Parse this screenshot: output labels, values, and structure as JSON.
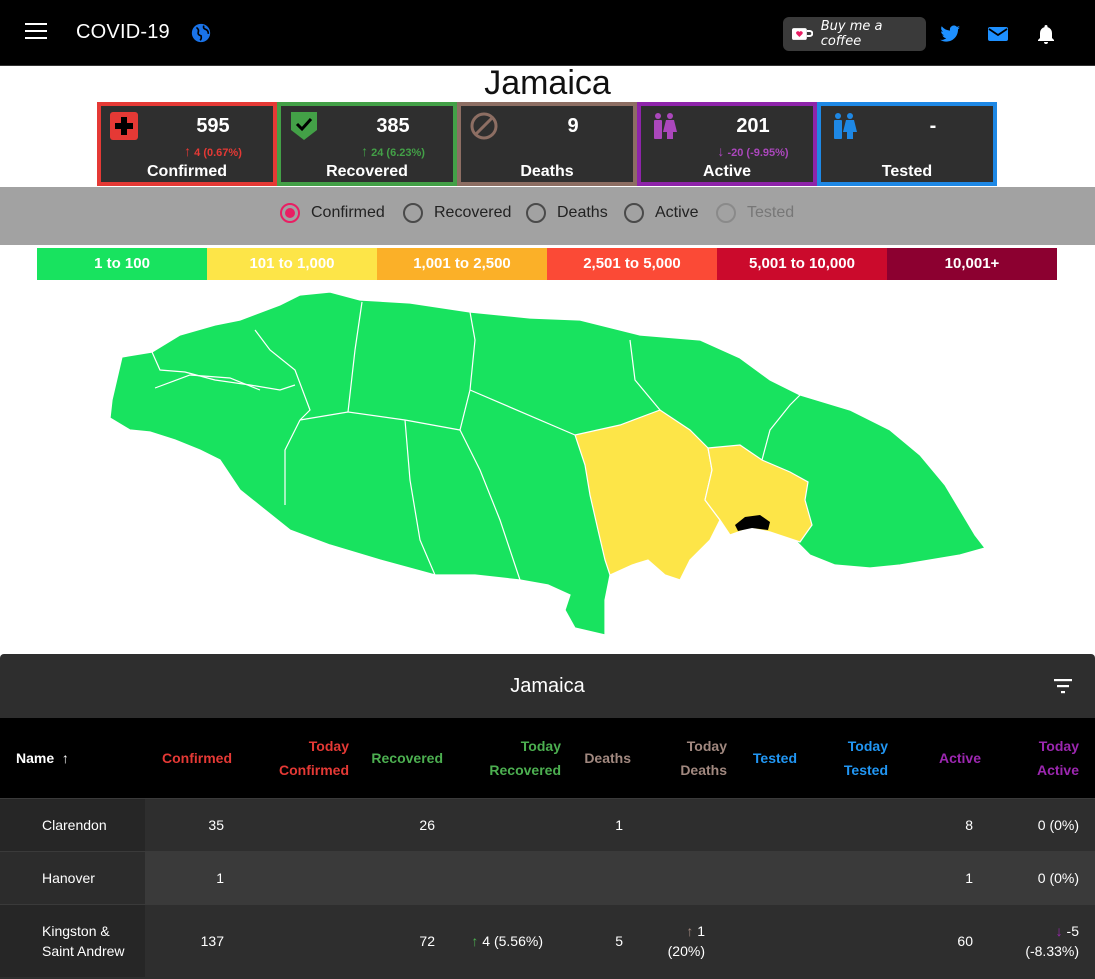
{
  "topbar": {
    "title": "COVID-19",
    "coffee_label": "Buy me a coffee"
  },
  "country": "Jamaica",
  "cards": [
    {
      "value": "595",
      "delta": "4 (0.67%)",
      "delta_dir": "up",
      "label": "Confirmed",
      "color": "#e53935"
    },
    {
      "value": "385",
      "delta": "24 (6.23%)",
      "delta_dir": "up",
      "label": "Recovered",
      "color": "#43a047"
    },
    {
      "value": "9",
      "delta": "",
      "delta_dir": "",
      "label": "Deaths",
      "color": "#8d6e63"
    },
    {
      "value": "201",
      "delta": "-20 (-9.95%)",
      "delta_dir": "down",
      "label": "Active",
      "color": "#8e24aa"
    },
    {
      "value": "-",
      "delta": "",
      "delta_dir": "",
      "label": "Tested",
      "color": "#1e88e5"
    }
  ],
  "radios": [
    {
      "label": "Confirmed",
      "selected": true
    },
    {
      "label": "Recovered",
      "selected": false
    },
    {
      "label": "Deaths",
      "selected": false
    },
    {
      "label": "Active",
      "selected": false
    },
    {
      "label": "Tested",
      "disabled": true
    }
  ],
  "legend": [
    {
      "label": "1 to 100",
      "color": "#18e35f"
    },
    {
      "label": "101 to 1,000",
      "color": "#fde548"
    },
    {
      "label": "1,001 to 2,500",
      "color": "#fbb028"
    },
    {
      "label": "2,501 to 5,000",
      "color": "#fb4a36"
    },
    {
      "label": "5,001 to 10,000",
      "color": "#cb0a2c"
    },
    {
      "label": "10,001+",
      "color": "#8c0030"
    }
  ],
  "table": {
    "title": "Jamaica",
    "headers": {
      "name": "Name",
      "confirmed": "Confirmed",
      "today_confirmed_1": "Today",
      "today_confirmed_2": "Confirmed",
      "recovered": "Recovered",
      "today_recovered_1": "Today",
      "today_recovered_2": "Recovered",
      "deaths": "Deaths",
      "today_deaths_1": "Today",
      "today_deaths_2": "Deaths",
      "tested": "Tested",
      "today_tested_1": "Today",
      "today_tested_2": "Tested",
      "active": "Active",
      "today_active_1": "Today",
      "today_active_2": "Active"
    },
    "rows": [
      {
        "name": "Clarendon",
        "confirmed": "35",
        "today_confirmed": "",
        "recovered": "26",
        "today_recovered": "",
        "deaths": "1",
        "today_deaths": "",
        "tested": "",
        "today_tested": "",
        "active": "8",
        "today_active": "0 (0%)"
      },
      {
        "name": "Hanover",
        "confirmed": "1",
        "today_confirmed": "",
        "recovered": "",
        "today_recovered": "",
        "deaths": "",
        "today_deaths": "",
        "tested": "",
        "today_tested": "",
        "active": "1",
        "today_active": "0 (0%)"
      },
      {
        "name_1": "Kingston &",
        "name_2": "Saint Andrew",
        "confirmed": "137",
        "today_confirmed": "",
        "recovered": "72",
        "today_recovered": "4 (5.56%)",
        "deaths": "5",
        "today_deaths_1": "1",
        "today_deaths_2": "(20%)",
        "tested": "",
        "today_tested": "",
        "active": "60",
        "today_active_1": "-5",
        "today_active_2": "(-8.33%)"
      }
    ]
  },
  "colors": {
    "confirmed": "#e53935",
    "recovered": "#4caf50",
    "deaths": "#a1887f",
    "tested": "#2196f3",
    "active": "#9c27b0",
    "map_green": "#18e35f",
    "map_yellow": "#fde548"
  }
}
